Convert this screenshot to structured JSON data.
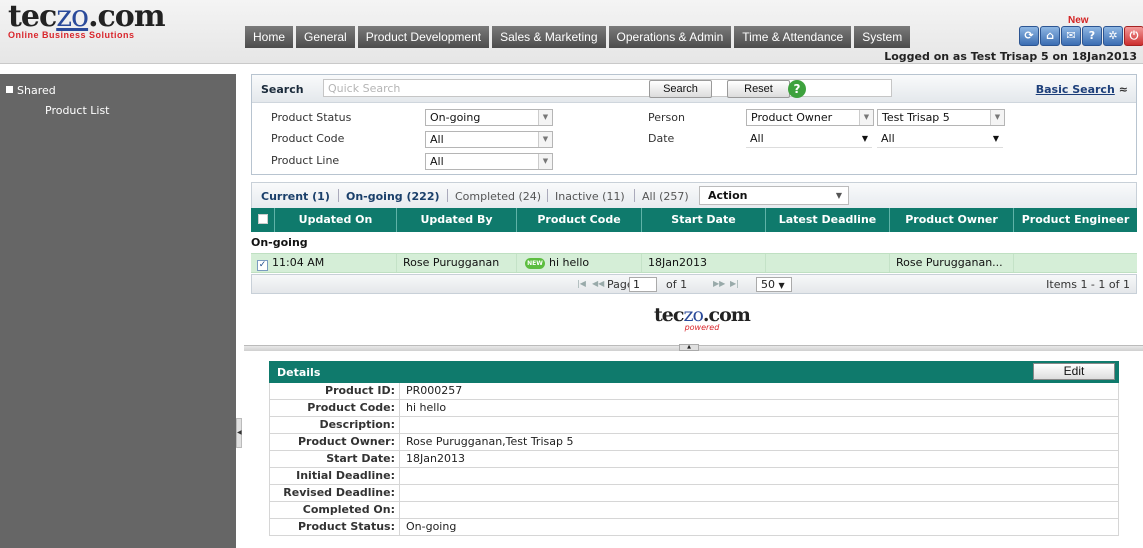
{
  "app": {
    "logo_main_pre": "tec",
    "logo_main_zo": "zo",
    "logo_main_post": ".com",
    "logo_sub": "Online Business Solutions",
    "new_badge": "New",
    "logged_on": "Logged on as Test Trisap 5 on 18Jan2013"
  },
  "nav": {
    "tabs": [
      "Home",
      "General",
      "Product Development",
      "Sales & Marketing",
      "Operations & Admin",
      "Time & Attendance",
      "System"
    ]
  },
  "sidebar": {
    "section": "Shared",
    "item": "Product List"
  },
  "search": {
    "title": "Search",
    "placeholder": "Quick Search",
    "search_btn": "Search",
    "reset_btn": "Reset",
    "help": "?",
    "basic_search": "Basic Search",
    "filters": {
      "product_status_label": "Product Status",
      "product_status_value": "On-going",
      "product_code_label": "Product Code",
      "product_code_value": "All",
      "product_line_label": "Product Line",
      "product_line_value": "All",
      "person_label": "Person",
      "person_role_value": "Product Owner",
      "person_name_value": "Test Trisap 5",
      "date_label": "Date",
      "date_value_1": "All",
      "date_value_2": "All"
    }
  },
  "filter_tabs": {
    "current": "Current (1)",
    "ongoing": "On-going (222)",
    "completed": "Completed (24)",
    "inactive": "Inactive (11)",
    "all": "All (257)",
    "action": "Action"
  },
  "grid": {
    "columns": [
      "Updated On",
      "Updated By",
      "Product Code",
      "Start Date",
      "Latest Deadline",
      "Product Owner",
      "Product Engineer"
    ],
    "group": "On-going",
    "rows": [
      {
        "updated_on": "11:04 AM",
        "updated_by": "Rose  Purugganan",
        "new_tag": "NEW",
        "product_code": "hi hello",
        "start_date": "18Jan2013",
        "latest_deadline": "",
        "product_owner": "Rose  Purugganan...",
        "product_engineer": ""
      }
    ]
  },
  "pager": {
    "page_label": "Page",
    "page_value": "1",
    "of_label": "of 1",
    "page_size": "50",
    "items": "Items 1 - 1 of 1"
  },
  "powered": {
    "logo_pre": "tec",
    "logo_zo": "zo",
    "logo_post": ".com",
    "sub": "powered"
  },
  "details": {
    "title": "Details",
    "edit_btn": "Edit",
    "fields": [
      {
        "label": "Product ID:",
        "value": "PR000257"
      },
      {
        "label": "Product Code:",
        "value": "hi hello"
      },
      {
        "label": "Description:",
        "value": ""
      },
      {
        "label": "Product Owner:",
        "value": "Rose  Purugganan,Test Trisap 5"
      },
      {
        "label": "Start Date:",
        "value": "18Jan2013"
      },
      {
        "label": "Initial Deadline:",
        "value": ""
      },
      {
        "label": "Revised Deadline:",
        "value": ""
      },
      {
        "label": "Completed On:",
        "value": ""
      },
      {
        "label": "Product Status:",
        "value": "On-going"
      }
    ]
  }
}
